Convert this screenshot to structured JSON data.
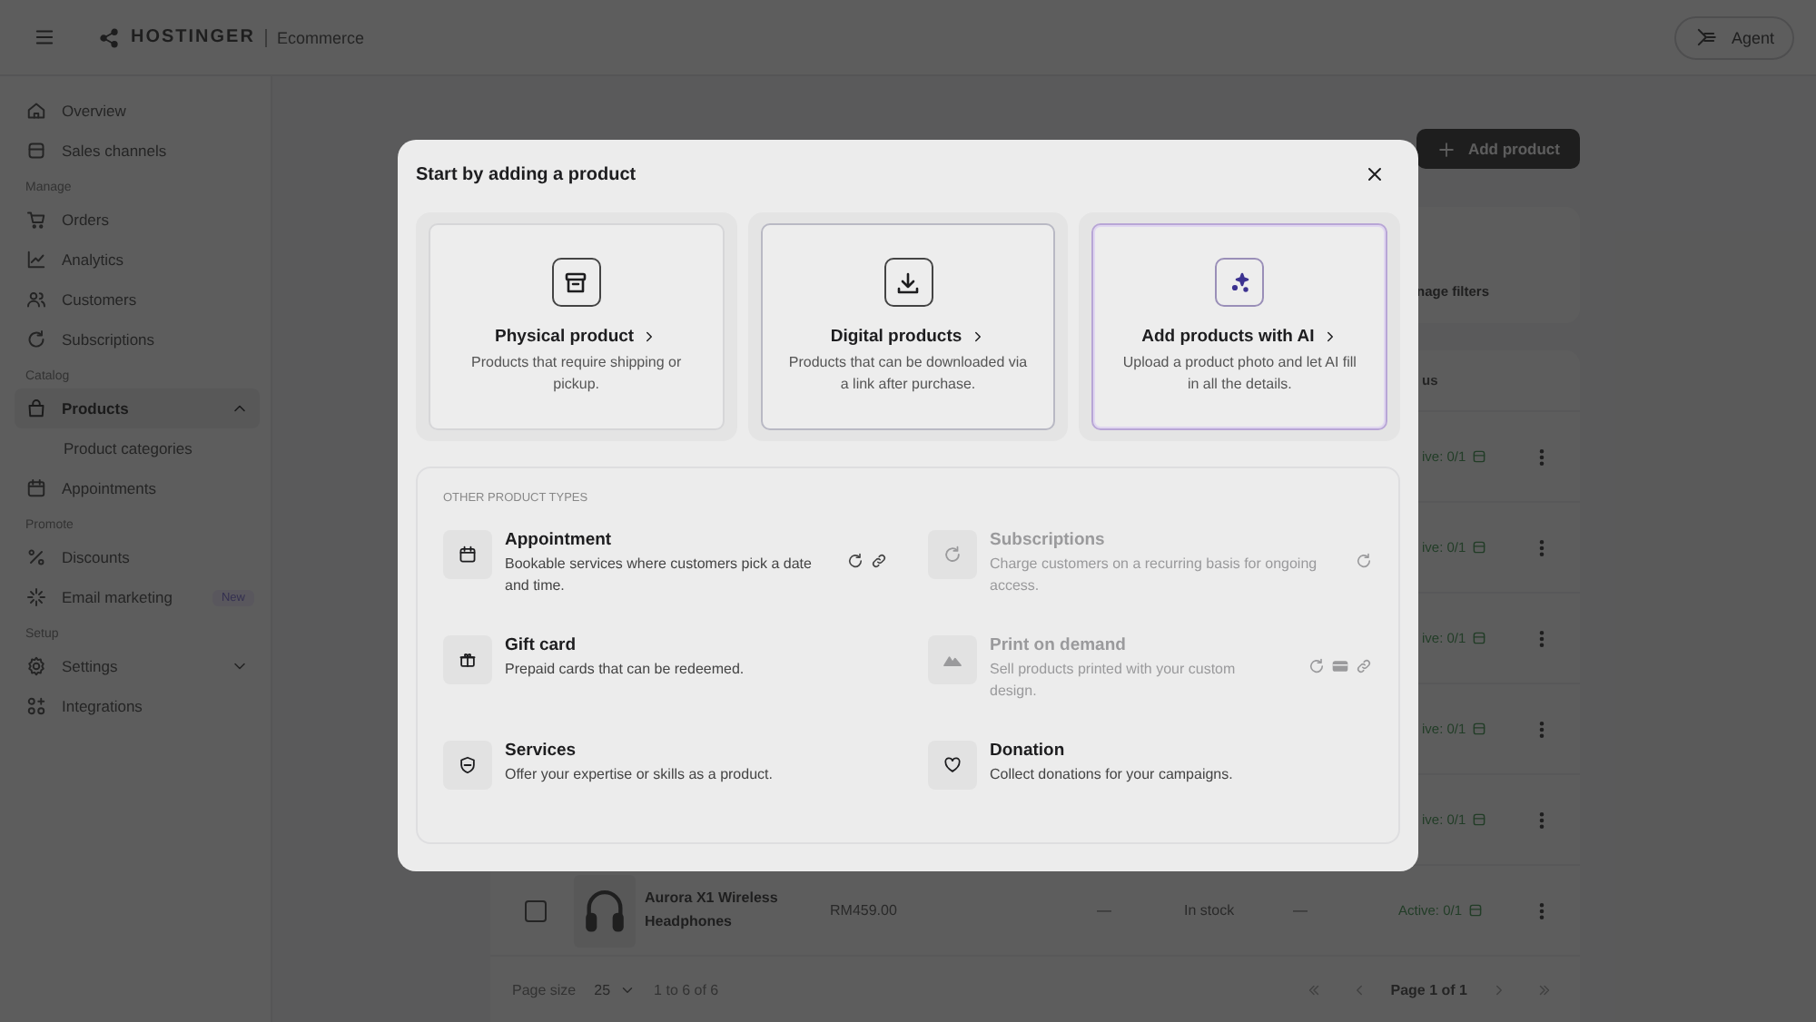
{
  "top_bar": {
    "brand": "HOSTINGER",
    "product": "Ecommerce",
    "agent_button": "Agent"
  },
  "sidebar": {
    "sections": [
      {
        "items": [
          {
            "label": "Overview",
            "selected": false
          },
          {
            "label": "Sales channels",
            "selected": false
          }
        ]
      },
      {
        "label": "Manage",
        "items": [
          {
            "label": "Orders",
            "selected": false
          },
          {
            "label": "Analytics",
            "selected": false
          },
          {
            "label": "Customers",
            "selected": false
          },
          {
            "label": "Subscriptions",
            "selected": false
          }
        ]
      },
      {
        "label": "Catalog",
        "items": [
          {
            "label": "Products",
            "selected": true,
            "expanded": true,
            "children": [
              {
                "label": "Product categories",
                "selected": false
              }
            ]
          },
          {
            "label": "Appointments",
            "selected": false
          }
        ]
      },
      {
        "label": "Promote",
        "items": [
          {
            "label": "Discounts",
            "selected": false
          },
          {
            "label": "Email marketing",
            "selected": false,
            "badge": "New"
          }
        ]
      },
      {
        "label": "Setup",
        "items": [
          {
            "label": "Settings",
            "selected": false,
            "expanded": false
          },
          {
            "label": "Integrations",
            "selected": false
          }
        ]
      }
    ]
  },
  "page": {
    "add_button": "Add product",
    "filters_link": "nage filters",
    "table": {
      "status_header": "us",
      "rows": [
        {
          "status": "ive: 0/1"
        },
        {
          "status": "ive: 0/1"
        },
        {
          "status": "ive: 0/1"
        },
        {
          "status": "ive: 0/1"
        },
        {
          "status": "ive: 0/1"
        },
        {
          "checked": false,
          "name": "Aurora X1 Wireless Headphones",
          "price": "RM459.00",
          "column_4": "—",
          "stock": "In stock",
          "column_6": "—",
          "status": "Active: 0/1"
        }
      ]
    },
    "pagination": {
      "page_size_label": "Page size",
      "page_size": "25",
      "range": "1 to 6 of 6",
      "page": "Page 1 of 1"
    }
  },
  "modal": {
    "title": "Start by adding a product",
    "main_options": [
      {
        "title": "Physical product",
        "description": "Products that require shipping or pickup."
      },
      {
        "title": "Digital products",
        "description": "Products that can be downloaded via a link after purchase."
      },
      {
        "title": "Add products with AI",
        "description": "Upload a product photo and let AI fill in all the details."
      }
    ],
    "other_types_label": "OTHER PRODUCT TYPES",
    "other_types": [
      {
        "title": "Appointment",
        "description": "Bookable services where customers pick a date and time.",
        "disabled": false
      },
      {
        "title": "Subscriptions",
        "description": "Charge customers on a recurring basis for ongoing access.",
        "disabled": true
      },
      {
        "title": "Gift card",
        "description": "Prepaid cards that can be redeemed.",
        "disabled": false
      },
      {
        "title": "Print on demand",
        "description": "Sell products printed with your custom design.",
        "disabled": true
      },
      {
        "title": "Services",
        "description": "Offer your expertise or skills as a product.",
        "disabled": false
      },
      {
        "title": "Donation",
        "description": "Collect donations for your campaigns.",
        "disabled": false
      }
    ]
  }
}
